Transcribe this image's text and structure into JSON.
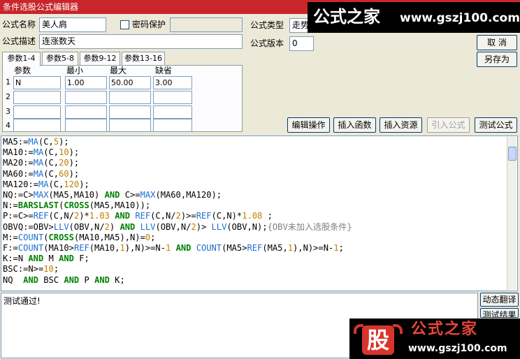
{
  "window": {
    "title": "条件选股公式编辑器"
  },
  "form": {
    "name_label": "公式名称",
    "name_value": "美人肩",
    "password_label": "密码保护",
    "desc_label": "公式描述",
    "desc_value": "连涨数天",
    "type_label": "公式类型",
    "type_value": "走势",
    "version_label": "公式版本",
    "version_value": "0"
  },
  "buttons": {
    "cancel": "取  消",
    "save_as": "另存为",
    "edit_op": "编辑操作",
    "insert_func": "插入函数",
    "insert_res": "插入资源",
    "import_formula": "引入公式",
    "test_formula": "测试公式",
    "dynamic_translate": "动态翻译",
    "test_result": "测试结果"
  },
  "tabs": [
    "参数1-4",
    "参数5-8",
    "参数9-12",
    "参数13-16"
  ],
  "params": {
    "headers": [
      "参数",
      "最小",
      "最大",
      "缺省"
    ],
    "rows": [
      {
        "num": "1",
        "name": "N",
        "min": "1.00",
        "max": "50.00",
        "def": "3.00"
      },
      {
        "num": "2",
        "name": "",
        "min": "",
        "max": "",
        "def": ""
      },
      {
        "num": "3",
        "name": "",
        "min": "",
        "max": "",
        "def": ""
      },
      {
        "num": "4",
        "name": "",
        "min": "",
        "max": "",
        "def": ""
      }
    ]
  },
  "code_lines": [
    [
      [
        "v",
        "MA5:="
      ],
      [
        "fn",
        "MA"
      ],
      [
        "v",
        "(C,"
      ],
      [
        "num",
        "5"
      ],
      [
        "v",
        ");"
      ]
    ],
    [
      [
        "v",
        "MA10:="
      ],
      [
        "fn",
        "MA"
      ],
      [
        "v",
        "(C,"
      ],
      [
        "num",
        "10"
      ],
      [
        "v",
        ");"
      ]
    ],
    [
      [
        "v",
        "MA20:="
      ],
      [
        "fn",
        "MA"
      ],
      [
        "v",
        "(C,"
      ],
      [
        "num",
        "20"
      ],
      [
        "v",
        ");"
      ]
    ],
    [
      [
        "v",
        "MA60:="
      ],
      [
        "fn",
        "MA"
      ],
      [
        "v",
        "(C,"
      ],
      [
        "num",
        "60"
      ],
      [
        "v",
        ");"
      ]
    ],
    [
      [
        "v",
        "MA120:="
      ],
      [
        "fn",
        "MA"
      ],
      [
        "v",
        "(C,"
      ],
      [
        "num",
        "120"
      ],
      [
        "v",
        ");"
      ]
    ],
    [
      [
        "v",
        "NQ:=C>"
      ],
      [
        "fn",
        "MAX"
      ],
      [
        "v",
        "(MA5,MA10) "
      ],
      [
        "kw",
        "AND"
      ],
      [
        "v",
        " C>="
      ],
      [
        "fn",
        "MAX"
      ],
      [
        "v",
        "(MA60,MA120);"
      ]
    ],
    [
      [
        "v",
        "N:="
      ],
      [
        "kw",
        "BARSLAST"
      ],
      [
        "v",
        "("
      ],
      [
        "kw",
        "CROSS"
      ],
      [
        "v",
        "(MA5,MA10));"
      ]
    ],
    [
      [
        "v",
        "P:=C>="
      ],
      [
        "fn",
        "REF"
      ],
      [
        "v",
        "(C,N/"
      ],
      [
        "num",
        "2"
      ],
      [
        "v",
        ")*"
      ],
      [
        "num",
        "1.03"
      ],
      [
        "v",
        " "
      ],
      [
        "kw",
        "AND"
      ],
      [
        "v",
        " "
      ],
      [
        "fn",
        "REF"
      ],
      [
        "v",
        "(C,N/"
      ],
      [
        "num",
        "2"
      ],
      [
        "v",
        ")>="
      ],
      [
        "fn",
        "REF"
      ],
      [
        "v",
        "(C,N)*"
      ],
      [
        "num",
        "1.08"
      ],
      [
        "v",
        " ;"
      ]
    ],
    [
      [
        "v",
        "OBVQ:=OBV>"
      ],
      [
        "fn",
        "LLV"
      ],
      [
        "v",
        "(OBV,N/"
      ],
      [
        "num",
        "2"
      ],
      [
        "v",
        ") "
      ],
      [
        "kw",
        "AND"
      ],
      [
        "v",
        " "
      ],
      [
        "fn",
        "LLV"
      ],
      [
        "v",
        "(OBV,N/"
      ],
      [
        "num",
        "2"
      ],
      [
        "v",
        ")> "
      ],
      [
        "fn",
        "LLV"
      ],
      [
        "v",
        "(OBV,N);"
      ],
      [
        "cm",
        "{OBV未加入选股条件}"
      ]
    ],
    [
      [
        "v",
        "M:="
      ],
      [
        "fn",
        "COUNT"
      ],
      [
        "v",
        "("
      ],
      [
        "kw",
        "CROSS"
      ],
      [
        "v",
        "(MA10,MA5),N)="
      ],
      [
        "num",
        "0"
      ],
      [
        "v",
        ";"
      ]
    ],
    [
      [
        "v",
        "F:="
      ],
      [
        "fn",
        "COUNT"
      ],
      [
        "v",
        "(MA10>"
      ],
      [
        "fn",
        "REF"
      ],
      [
        "v",
        "(MA10,"
      ],
      [
        "num",
        "1"
      ],
      [
        "v",
        "),N)>=N-"
      ],
      [
        "num",
        "1"
      ],
      [
        "v",
        " "
      ],
      [
        "kw",
        "AND"
      ],
      [
        "v",
        " "
      ],
      [
        "fn",
        "COUNT"
      ],
      [
        "v",
        "(MA5>"
      ],
      [
        "fn",
        "REF"
      ],
      [
        "v",
        "(MA5,"
      ],
      [
        "num",
        "1"
      ],
      [
        "v",
        "),N)>=N-"
      ],
      [
        "num",
        "1"
      ],
      [
        "v",
        ";"
      ]
    ],
    [
      [
        "v",
        "K:=N "
      ],
      [
        "kw",
        "AND"
      ],
      [
        "v",
        " M "
      ],
      [
        "kw",
        "AND"
      ],
      [
        "v",
        " F;"
      ]
    ],
    [
      [
        "v",
        "BSC:=N>="
      ],
      [
        "num",
        "10"
      ],
      [
        "v",
        ";"
      ]
    ],
    [
      [
        "v",
        "NQ  "
      ],
      [
        "kw",
        "AND"
      ],
      [
        "v",
        " BSC "
      ],
      [
        "kw",
        "AND"
      ],
      [
        "v",
        " P "
      ],
      [
        "kw",
        "AND"
      ],
      [
        "v",
        " K;"
      ]
    ]
  ],
  "output": {
    "text": "测试通过!"
  },
  "watermark": {
    "top_brand": "公式之家",
    "top_url": "www.gszj100.com",
    "bottom_logo_char": "股",
    "bottom_brand": "公式之家",
    "bottom_url": "www.gszj100.com"
  },
  "colors": {
    "title_bar": "#c8262a",
    "function": "#1d6fd0",
    "keyword": "#008000",
    "number": "#c08000",
    "comment": "#808080"
  }
}
